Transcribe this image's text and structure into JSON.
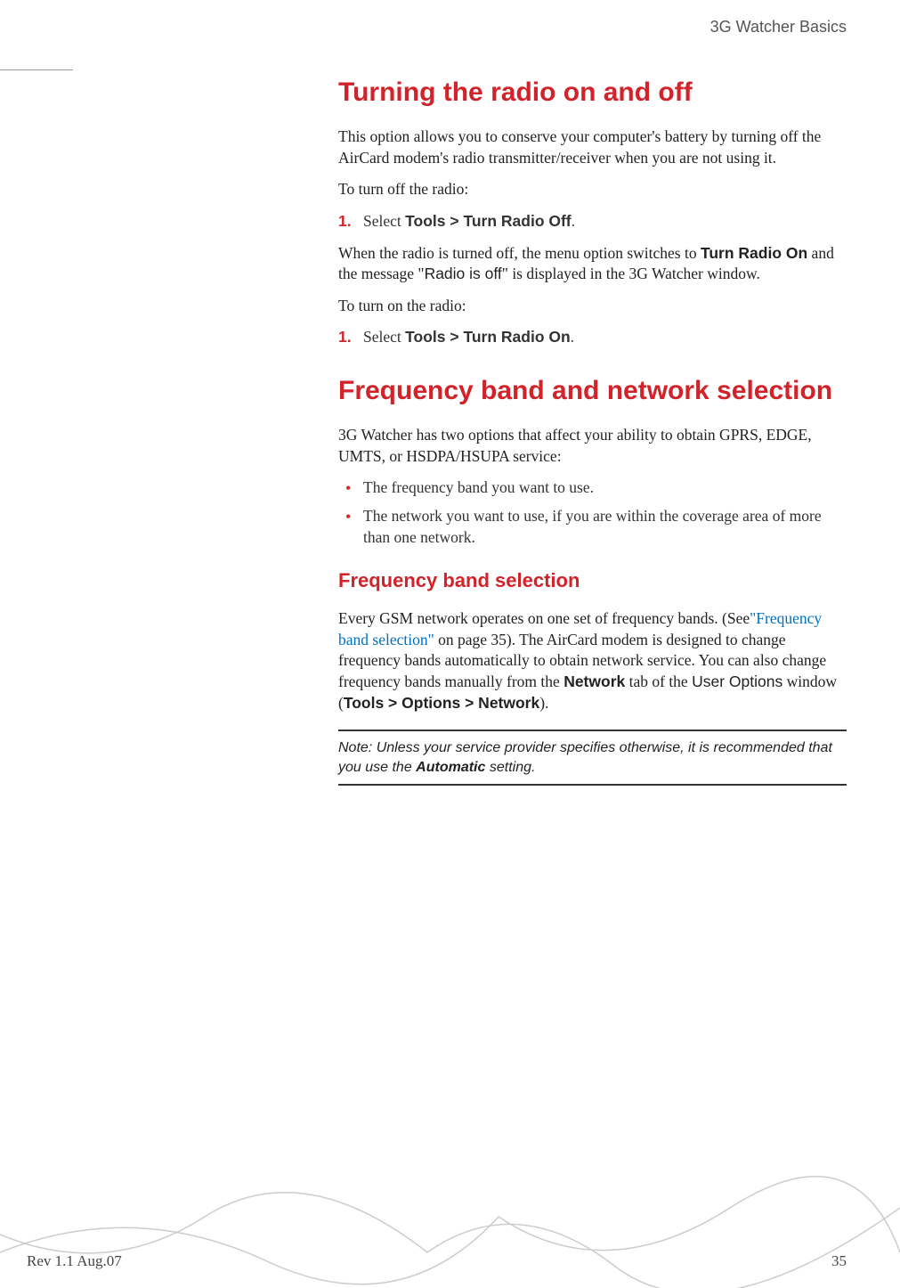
{
  "header": {
    "chapter_title": "3G Watcher Basics"
  },
  "section1": {
    "heading": "Turning the radio on and off",
    "para1": "This option allows you to conserve your computer's battery by turning off the AirCard modem's radio transmitter/receiver when you are not using it.",
    "para2": "To turn off the radio:",
    "step1_num": "1.",
    "step1_pre": "Select ",
    "step1_bold": "Tools > Turn Radio Off",
    "step1_post": ".",
    "para3_pre": "When the radio is turned off, the menu option switches to ",
    "para3_b1": "Turn Radio On",
    "para3_mid": " and the message \"",
    "para3_s1": "Radio is off",
    "para3_post": "\" is displayed in the 3G Watcher window.",
    "para4": "To turn on the radio:",
    "step2_num": "1.",
    "step2_pre": "Select ",
    "step2_bold": "Tools > Turn Radio On",
    "step2_post": "."
  },
  "section2": {
    "heading": "Frequency band and network selection",
    "para1": "3G Watcher has two options that affect your ability to obtain GPRS, EDGE, UMTS, or HSDPA/HSUPA service:",
    "bullet1": "The frequency band you want to use.",
    "bullet2": "The network you want to use, if you are within the coverage area of more than one network.",
    "subheading": "Frequency band selection",
    "para2_pre": "Every GSM network operates on one set of frequency bands. (See",
    "para2_link": "\"Frequency band selection\"",
    "para2_mid1": " on page 35). The AirCard modem is designed to change frequency bands automatically to obtain network service. You can also change frequency bands manually from the ",
    "para2_b1": "Network",
    "para2_mid2": " tab of the ",
    "para2_s1": "User Options",
    "para2_mid3": " window (",
    "para2_b2": "Tools > Options > Network",
    "para2_post": ").",
    "note_pre": "Note:  Unless your service provider specifies otherwise, it is recommended that you use the ",
    "note_bold": "Automatic",
    "note_post": " setting."
  },
  "footer": {
    "rev": "Rev 1.1  Aug.07",
    "page": "35"
  }
}
